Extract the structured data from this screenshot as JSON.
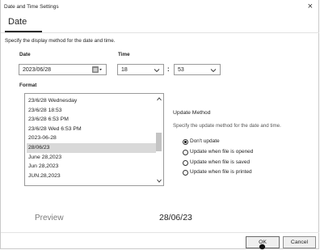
{
  "window": {
    "title": "Date and Time Settings",
    "close_glyph": "×"
  },
  "tabs": [
    {
      "label": "Date",
      "active": true
    }
  ],
  "description": "Specify the display method for the date and time.",
  "date": {
    "label": "Date",
    "value": "2023/06/28"
  },
  "time": {
    "label": "Time",
    "hour": "18",
    "minute": "53",
    "separator": ":"
  },
  "format": {
    "label": "Format",
    "options": [
      "23/6/28 Wednesday",
      "23/6/28 18:53",
      "23/6/28 6:53 PM",
      "23/6/28 Wed 6:53 PM",
      "2023-06-28",
      "28/06/23",
      "June 28,2023",
      "Jun 28,2023",
      "JUN.28,2023"
    ],
    "selected": "28/06/23"
  },
  "update_method": {
    "title": "Update Method",
    "description": "Specify the update method for the date and time.",
    "options": [
      {
        "label": "Don't update",
        "checked": true
      },
      {
        "label": "Update when file is opened",
        "checked": false
      },
      {
        "label": "Update when file is saved",
        "checked": false
      },
      {
        "label": "Update when file is printed",
        "checked": false
      }
    ]
  },
  "preview": {
    "label": "Preview",
    "value": "28/06/23"
  },
  "buttons": {
    "ok": "OK",
    "cancel": "Cancel"
  },
  "colors": {
    "selection": "#d9d9d9",
    "border": "#9a9a9a",
    "text": "#1f1f1f"
  }
}
